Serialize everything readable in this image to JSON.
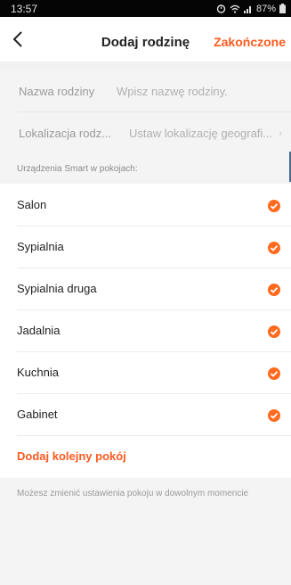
{
  "status": {
    "time": "13:57",
    "battery": "87%",
    "icons": [
      "alarm-icon",
      "wifi-icon",
      "signal-icon",
      "battery-icon"
    ]
  },
  "header": {
    "back_glyph": "<",
    "title": "Dodaj rodzinę",
    "done": "Zakończone"
  },
  "form": {
    "name_label": "Nazwa rodziny",
    "name_placeholder": "Wpisz nazwę rodziny.",
    "location_label": "Lokalizacja rodz...",
    "location_placeholder": "Ustaw lokalizację geografi..."
  },
  "rooms_header": "Urządzenia Smart w pokojach:",
  "rooms": [
    {
      "name": "Salon",
      "checked": true
    },
    {
      "name": "Sypialnia",
      "checked": true
    },
    {
      "name": "Sypialnia druga",
      "checked": true
    },
    {
      "name": "Jadalnia",
      "checked": true
    },
    {
      "name": "Kuchnia",
      "checked": true
    },
    {
      "name": "Gabinet",
      "checked": true
    }
  ],
  "add_room": "Dodaj kolejny pokój",
  "footer_note": "Możesz zmienić ustawienia pokoju w dowolnym momencie",
  "colors": {
    "accent": "#ff5a1f",
    "background": "#f4f4f4"
  }
}
